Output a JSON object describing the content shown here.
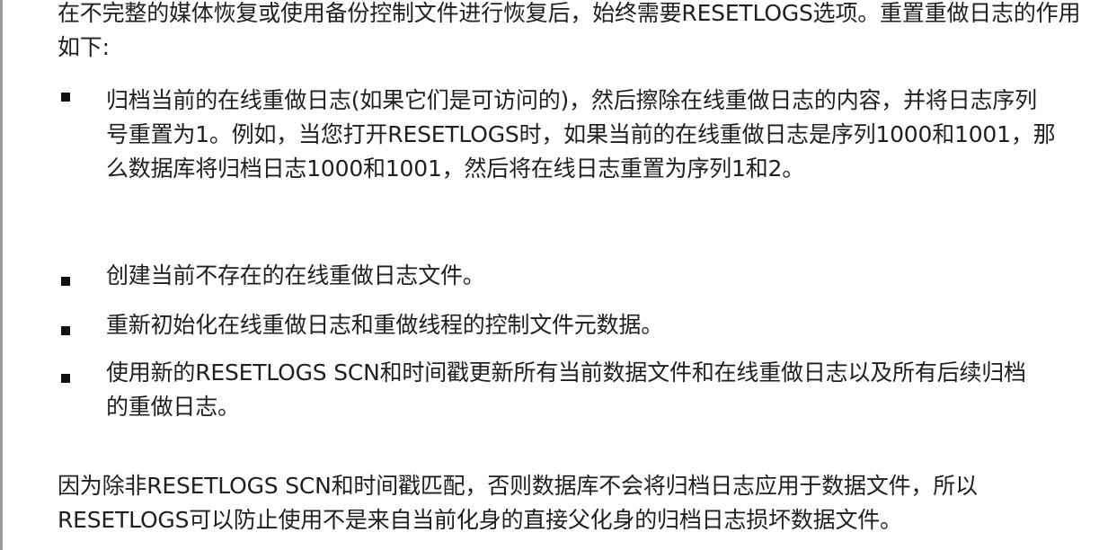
{
  "intro": "在不完整的媒体恢复或使用备份控制文件进行恢复后，始终需要RESETLOGS选项。重置重做日志的作用如下:",
  "bullets": [
    "归档当前的在线重做日志(如果它们是可访问的)，然后擦除在线重做日志的内容，并将日志序列号重置为1。例如，当您打开RESETLOGS时，如果当前的在线重做日志是序列1000和1001，那么数据库将归档日志1000和1001，然后将在线日志重置为序列1和2。",
    "创建当前不存在的在线重做日志文件。",
    "重新初始化在线重做日志和重做线程的控制文件元数据。",
    "使用新的RESETLOGS SCN和时间戳更新所有当前数据文件和在线重做日志以及所有后续归档的重做日志。"
  ],
  "outro": "因为除非RESETLOGS SCN和时间戳匹配，否则数据库不会将归档日志应用于数据文件，所以RESETLOGS可以防止使用不是来自当前化身的直接父化身的归档日志损坏数据文件。"
}
